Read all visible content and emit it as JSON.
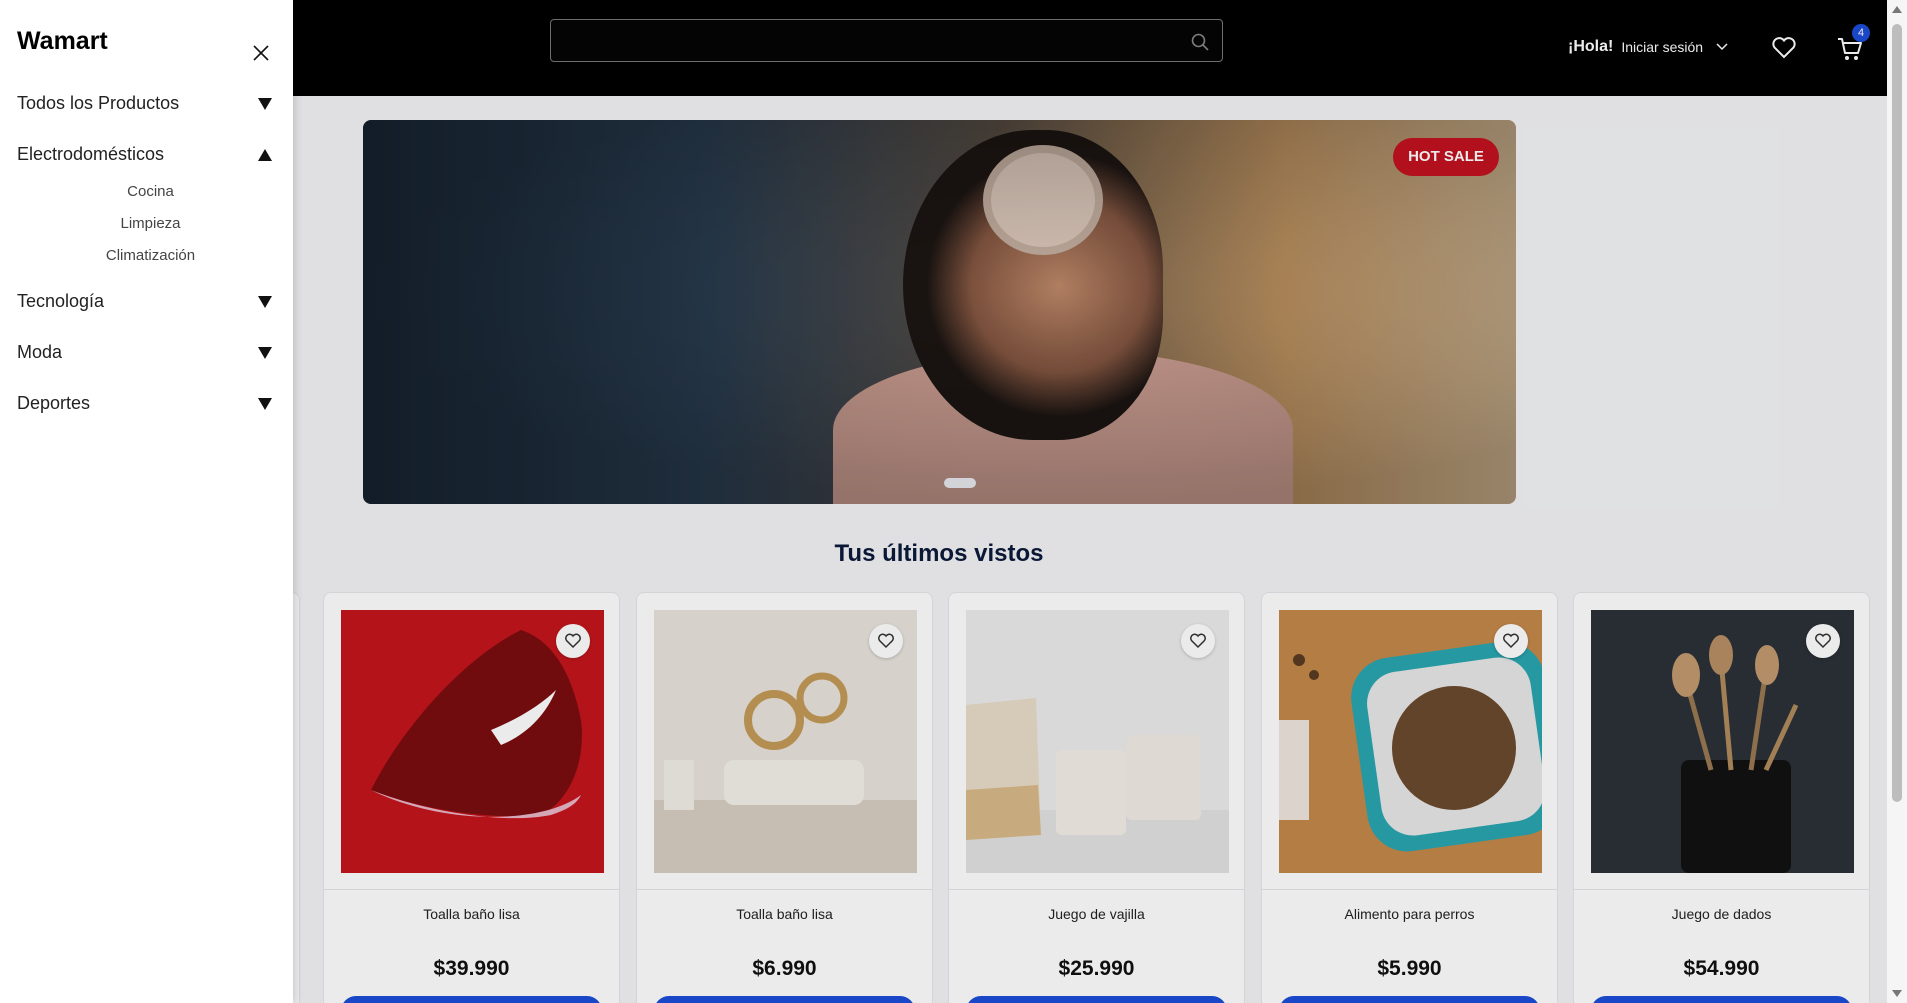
{
  "header": {
    "search_placeholder": "",
    "greeting": "¡Hola!",
    "login_label": "Iniciar sesión",
    "cart_count": "4"
  },
  "hero": {
    "badge": "HOT SALE"
  },
  "recent": {
    "title": "Tus últimos vistos",
    "products": [
      {
        "name": "Toalla baño lisa",
        "price": "$39.990",
        "image": "red-sneaker"
      },
      {
        "name": "Toalla baño lisa",
        "price": "$6.990",
        "image": "living-room"
      },
      {
        "name": "Juego de vajilla",
        "price": "$25.990",
        "image": "ceramic-cups"
      },
      {
        "name": "Alimento para perros",
        "price": "$5.990",
        "image": "dog-food-bowl"
      },
      {
        "name": "Juego de dados",
        "price": "$54.990",
        "image": "makeup-brushes"
      }
    ]
  },
  "drawer": {
    "brand": "Wamart",
    "categories": [
      {
        "label": "Todos los Productos",
        "expanded": false
      },
      {
        "label": "Electrodomésticos",
        "expanded": true,
        "subcategories": [
          "Cocina",
          "Limpieza",
          "Climatización"
        ]
      },
      {
        "label": "Tecnología",
        "expanded": false
      },
      {
        "label": "Moda",
        "expanded": false
      },
      {
        "label": "Deportes",
        "expanded": false
      }
    ]
  },
  "colors": {
    "header_bg": "#000000",
    "accent_blue": "#1d4ed8",
    "hot_sale_red": "#c1121f",
    "title_navy": "#0b1b3a"
  }
}
